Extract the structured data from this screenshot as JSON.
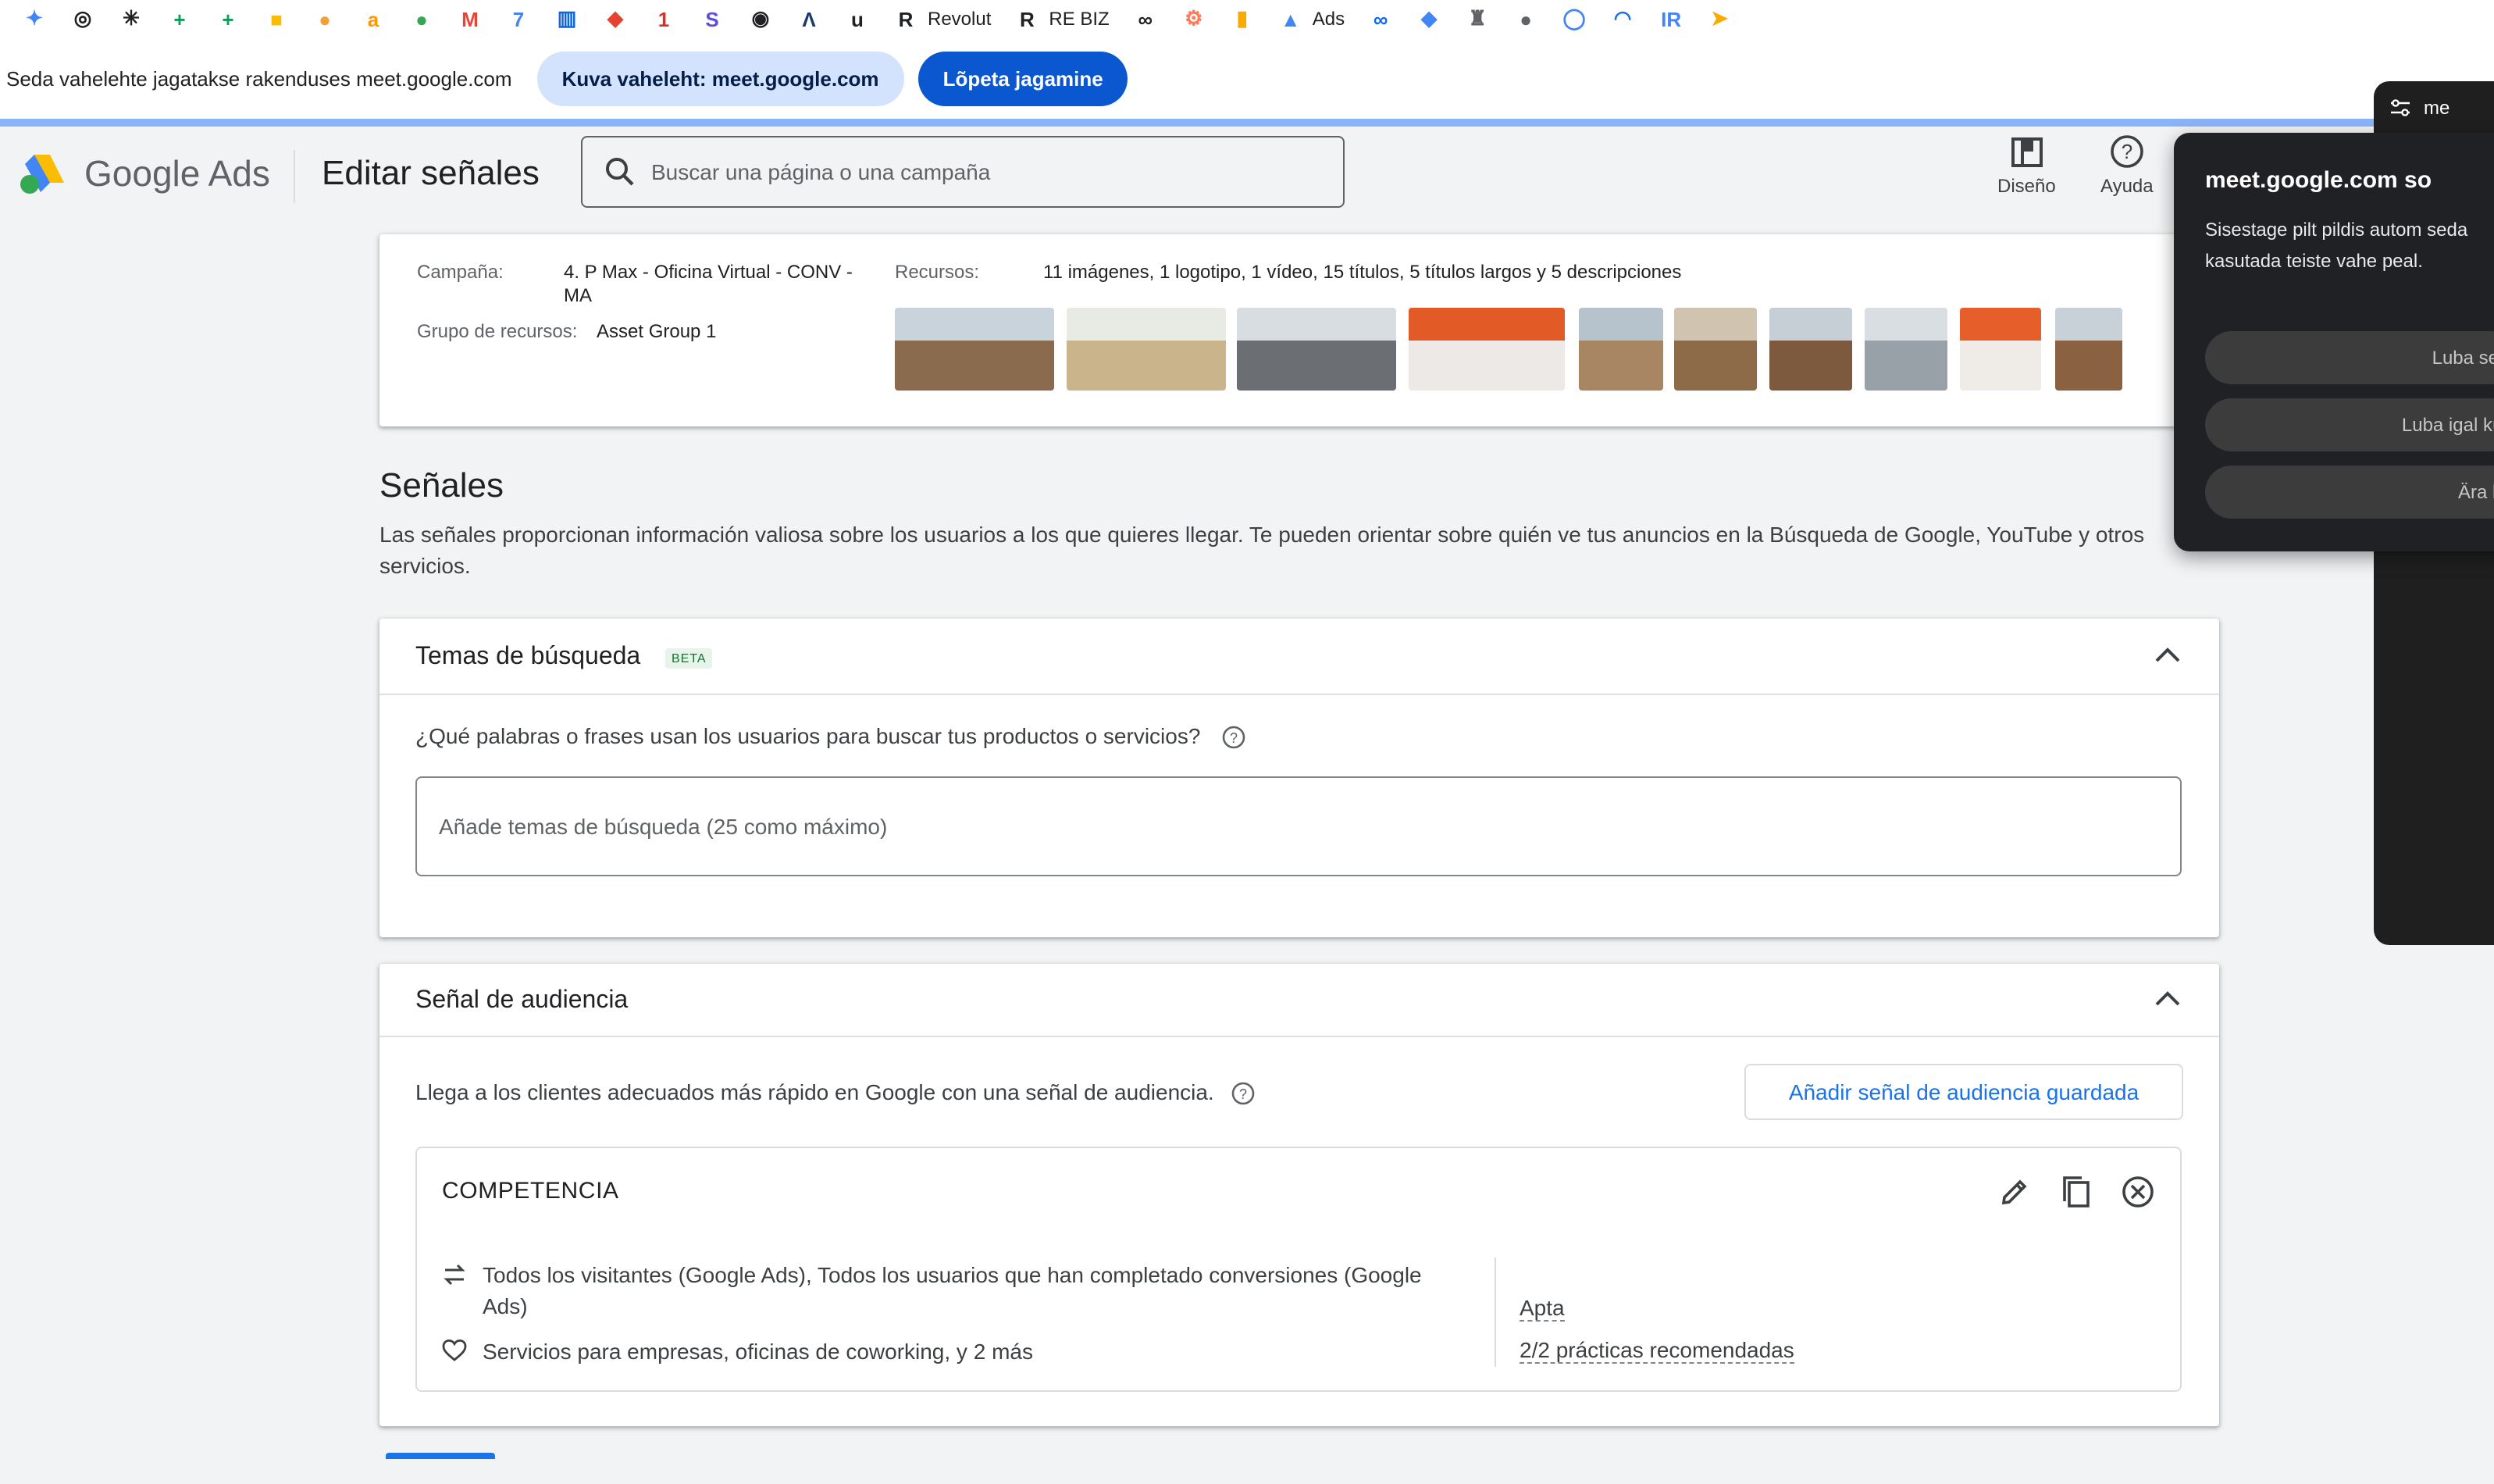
{
  "bookmarks": [
    {
      "label": "",
      "icon": "gemini-icon",
      "color": "#4285f4",
      "glyph": "✦"
    },
    {
      "label": "",
      "icon": "chatgpt-icon",
      "color": "#202124",
      "glyph": "◎"
    },
    {
      "label": "",
      "icon": "perplexity-icon",
      "color": "#202124",
      "glyph": "✳"
    },
    {
      "label": "",
      "icon": "sheets-icon",
      "color": "#0f9d58",
      "glyph": "+"
    },
    {
      "label": "",
      "icon": "sheets-icon-2",
      "color": "#0f9d58",
      "glyph": "+"
    },
    {
      "label": "",
      "icon": "keep-icon",
      "color": "#fbbc04",
      "glyph": "■"
    },
    {
      "label": "",
      "icon": "orange-circle-icon",
      "color": "#f4a03a",
      "glyph": "●"
    },
    {
      "label": "",
      "icon": "amazon-icon",
      "color": "#ff9900",
      "glyph": "a"
    },
    {
      "label": "",
      "icon": "green-circle-icon",
      "color": "#34a853",
      "glyph": "●"
    },
    {
      "label": "",
      "icon": "gmail-icon",
      "color": "#ea4335",
      "glyph": "M"
    },
    {
      "label": "",
      "icon": "calendar-icon",
      "color": "#4285f4",
      "glyph": "7"
    },
    {
      "label": "",
      "icon": "trello-icon",
      "color": "#0c66e4",
      "glyph": "▥"
    },
    {
      "label": "",
      "icon": "todoist-icon",
      "color": "#e44332",
      "glyph": "◆"
    },
    {
      "label": "",
      "icon": "notification-icon",
      "color": "#d93025",
      "glyph": "1"
    },
    {
      "label": "",
      "icon": "s-icon",
      "color": "#5b4fdb",
      "glyph": "S"
    },
    {
      "label": "",
      "icon": "yellow-app-icon",
      "color": "#202124",
      "glyph": "◉"
    },
    {
      "label": "",
      "icon": "a-app-icon",
      "color": "#1b3a6b",
      "glyph": "Λ"
    },
    {
      "label": "",
      "icon": "upwork-icon",
      "color": "#202124",
      "glyph": "u"
    },
    {
      "label": "Revolut",
      "icon": "revolut-icon",
      "color": "#202124",
      "glyph": "R"
    },
    {
      "label": "RE BIZ",
      "icon": "revolut-business-icon",
      "color": "#202124",
      "glyph": "R"
    },
    {
      "label": "",
      "icon": "infinity-icon",
      "color": "#202124",
      "glyph": "∞"
    },
    {
      "label": "",
      "icon": "hubspot-icon",
      "color": "#ff7a59",
      "glyph": "⚙"
    },
    {
      "label": "",
      "icon": "analytics-icon",
      "color": "#f9ab00",
      "glyph": "▮"
    },
    {
      "label": "Ads",
      "icon": "google-ads-icon",
      "color": "#4285f4",
      "glyph": "▲"
    },
    {
      "label": "",
      "icon": "meta-icon",
      "color": "#0866ff",
      "glyph": "∞"
    },
    {
      "label": "",
      "icon": "diamond-icon",
      "color": "#4285f4",
      "glyph": "◆"
    },
    {
      "label": "",
      "icon": "hat-icon",
      "color": "#5f6368",
      "glyph": "♜"
    },
    {
      "label": "",
      "icon": "apple-icon",
      "color": "#5f6368",
      "glyph": "●"
    },
    {
      "label": "",
      "icon": "ring-icon",
      "color": "#4285f4",
      "glyph": "◯"
    },
    {
      "label": "",
      "icon": "wave-icon",
      "color": "#1a73e8",
      "glyph": "◠"
    },
    {
      "label": "",
      "icon": "ir-icon",
      "color": "#4285f4",
      "glyph": "IR"
    },
    {
      "label": "",
      "icon": "bird-icon",
      "color": "#f9ab00",
      "glyph": "➤"
    }
  ],
  "share_bar": {
    "message": "Seda vahelehte jagatakse rakenduses meet.google.com",
    "view_button": "Kuva vaheleht: meet.google.com",
    "stop_button": "Lõpeta jagamine"
  },
  "header": {
    "logo_google": "Google",
    "logo_ads": "Ads",
    "page_title": "Editar señales",
    "search_placeholder": "Buscar una página o una campaña",
    "tools": [
      {
        "label": "Diseño",
        "icon": "layout-icon"
      },
      {
        "label": "Ayuda",
        "icon": "help-icon"
      }
    ]
  },
  "campaign": {
    "campaign_label": "Campaña:",
    "campaign_value_1": "4. P Max - Oficina Virtual - CONV -",
    "campaign_value_2": "MA",
    "group_label": "Grupo de recursos:",
    "group_value": "Asset Group 1",
    "resources_label": "Recursos:",
    "resources_value": "11 imágenes, 1 logotipo, 1 vídeo, 15 títulos, 5 títulos largos y 5 descripciones"
  },
  "thumbnails": [
    {
      "top": "#c9d3dc",
      "bottom": "#8a6b4e"
    },
    {
      "top": "#e8eae4",
      "bottom": "#c9b48c"
    },
    {
      "top": "#d8dde2",
      "bottom": "#6b6f74"
    },
    {
      "top": "#e25a26",
      "bottom": "#ece9e6"
    },
    {
      "top": "#b7c3cc",
      "bottom": "#a88563"
    },
    {
      "top": "#d0c4b0",
      "bottom": "#8d6a48"
    },
    {
      "top": "#c6ced6",
      "bottom": "#7d5a3d"
    },
    {
      "top": "#d9dee3",
      "bottom": "#98a0a8"
    },
    {
      "top": "#e65f2b",
      "bottom": "#efece8"
    },
    {
      "top": "#c8d0d8",
      "bottom": "#8a6242"
    }
  ],
  "signals": {
    "title": "Señales",
    "description": "Las señales proporcionan información valiosa sobre los usuarios a los que quieres llegar. Te pueden orientar sobre quién ve tus anuncios en la Búsqueda de Google, YouTube y otros servicios."
  },
  "search_themes": {
    "title": "Temas de búsqueda",
    "badge": "BETA",
    "question": "¿Qué palabras o frases usan los usuarios para buscar tus productos o servicios?",
    "input_placeholder": "Añade temas de búsqueda (25 como máximo)"
  },
  "audience": {
    "title": "Señal de audiencia",
    "description": "Llega a los clientes adecuados más rápido en Google con una señal de audiencia.",
    "add_button": "Añadir señal de audiencia guardada",
    "signal_name": "COMPETENCIA",
    "row1_line1": "Todos los visitantes (Google Ads), Todos los usuarios que han completado conversiones (Google",
    "row1_line2": "Ads)",
    "row2": "Servicios para empresas, oficinas de coworking, y 2 más",
    "status": "Apta",
    "best_practices": "2/2 prácticas recomendadas"
  },
  "popup": {
    "title": "meet.google.com so",
    "body": "Sisestage pilt pildis autom seda kasutada teiste vahe peal.",
    "buttons": [
      "Luba sel k",
      "Luba igal küla",
      "Ära lub"
    ]
  },
  "sidepanel": {
    "tab_label": "me"
  },
  "colors": {
    "primary_blue": "#1a73e8",
    "meet_blue": "#0b57d0",
    "share_stripe": "#8ab4f8"
  }
}
